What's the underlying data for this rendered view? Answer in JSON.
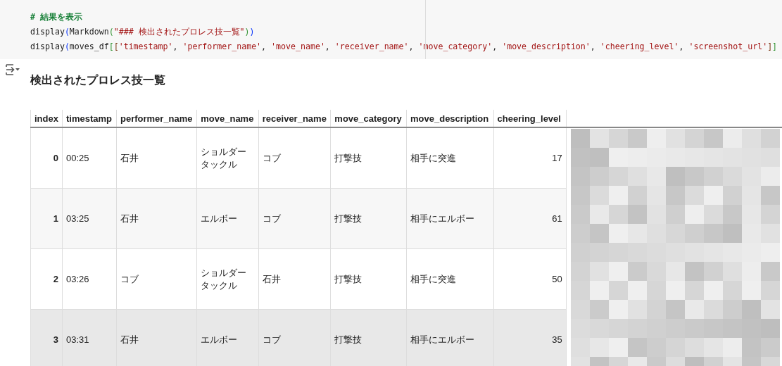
{
  "code_cell": {
    "lines": [
      [
        {
          "kind": "comment",
          "text": "# 結果を表示"
        }
      ],
      [
        {
          "kind": "plain",
          "text": "display"
        },
        {
          "kind": "bracket1",
          "text": "("
        },
        {
          "kind": "plain",
          "text": "Markdown"
        },
        {
          "kind": "bracket2",
          "text": "("
        },
        {
          "kind": "string",
          "text": "\"### 検出されたプロレス技一覧\""
        },
        {
          "kind": "bracket2",
          "text": ")"
        },
        {
          "kind": "bracket1",
          "text": ")"
        }
      ],
      [
        {
          "kind": "plain",
          "text": "display"
        },
        {
          "kind": "bracket1",
          "text": "("
        },
        {
          "kind": "plain",
          "text": "moves_df"
        },
        {
          "kind": "bracket2",
          "text": "["
        },
        {
          "kind": "bracket3",
          "text": "["
        },
        {
          "kind": "string",
          "text": "'timestamp'"
        },
        {
          "kind": "plain",
          "text": ", "
        },
        {
          "kind": "string",
          "text": "'performer_name'"
        },
        {
          "kind": "plain",
          "text": ", "
        },
        {
          "kind": "string",
          "text": "'move_name'"
        },
        {
          "kind": "plain",
          "text": ", "
        },
        {
          "kind": "string",
          "text": "'receiver_name'"
        },
        {
          "kind": "plain",
          "text": ", "
        },
        {
          "kind": "string",
          "text": "'move_category'"
        },
        {
          "kind": "plain",
          "text": ", "
        },
        {
          "kind": "string",
          "text": "'move_description'"
        },
        {
          "kind": "plain",
          "text": ", "
        },
        {
          "kind": "string",
          "text": "'cheering_level'"
        },
        {
          "kind": "plain",
          "text": ", "
        },
        {
          "kind": "string",
          "text": "'screenshot_url'"
        },
        {
          "kind": "bracket3",
          "text": "]"
        },
        {
          "kind": "bracket2",
          "text": "]"
        }
      ]
    ]
  },
  "output": {
    "heading": "検出されたプロレス技一覧",
    "table": {
      "columns": [
        "index",
        "timestamp",
        "performer_name",
        "move_name",
        "receiver_name",
        "move_category",
        "move_description",
        "cheering_level"
      ],
      "rows": [
        {
          "hovered": false,
          "cells": [
            "0",
            "00:25",
            "石井",
            "ショルダータックル",
            "コブ",
            "打撃技",
            "相手に突進",
            "17"
          ]
        },
        {
          "hovered": false,
          "cells": [
            "1",
            "03:25",
            "石井",
            "エルボー",
            "コブ",
            "打撃技",
            "相手にエルボー",
            "61"
          ]
        },
        {
          "hovered": false,
          "cells": [
            "2",
            "03:26",
            "コブ",
            "ショルダータックル",
            "石井",
            "打撃技",
            "相手に突進",
            "50"
          ]
        },
        {
          "hovered": true,
          "cells": [
            "3",
            "03:31",
            "石井",
            "エルボー",
            "コブ",
            "打撃技",
            "相手にエルボー",
            "35"
          ]
        }
      ]
    }
  }
}
